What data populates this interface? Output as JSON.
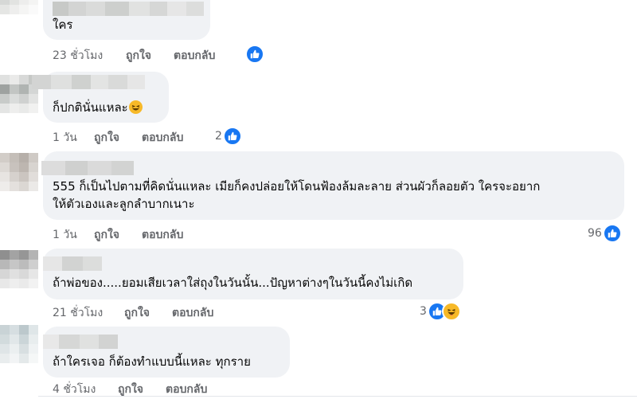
{
  "comments": [
    {
      "text": "ใคร",
      "time": "23 ชั่วโมง",
      "like_label": "ถูกใจ",
      "reply_label": "ตอบกลับ",
      "reaction_count": ""
    },
    {
      "text": "ก็ปกตินั่นแหละ",
      "time": "1 วัน",
      "like_label": "ถูกใจ",
      "reply_label": "ตอบกลับ",
      "reaction_count": "2"
    },
    {
      "text_line1": "555 ก็เป็นไปตามที่คิดนั่นแหละ เมียก็คงปล่อยให้โดนฟ้องล้มละลาย ส่วนผัวก็ลอยตัว ใครจะอยาก",
      "text_line2": "ให้ตัวเองและลูกลำบากเนาะ",
      "time": "1 วัน",
      "like_label": "ถูกใจ",
      "reply_label": "ตอบกลับ",
      "reaction_count": "96"
    },
    {
      "text": "ถ้าพ่อของ.....ยอมเสียเวลาใส่ถุงในวันนั้น...ปัญหาต่างๆในวันนี้คงไม่เกิด",
      "time": "21 ชั่วโมง",
      "like_label": "ถูกใจ",
      "reply_label": "ตอบกลับ",
      "reaction_count": "3"
    },
    {
      "text": "ถ้าใครเจอ ก็ต้องทำแบบนี้แหละ ทุกราย",
      "time": "4 ชั่วโมง",
      "like_label": "ถูกใจ",
      "reply_label": "ตอบกลับ",
      "reaction_count": ""
    }
  ],
  "colors": {
    "bubble": "#f0f2f5",
    "like_blue": "#1877f2",
    "laugh_yellow": "#f7b928",
    "meta_gray": "#65676b"
  },
  "icons": [
    "like-reaction-icon",
    "haha-reaction-icon",
    "grinning-emoji-icon"
  ]
}
